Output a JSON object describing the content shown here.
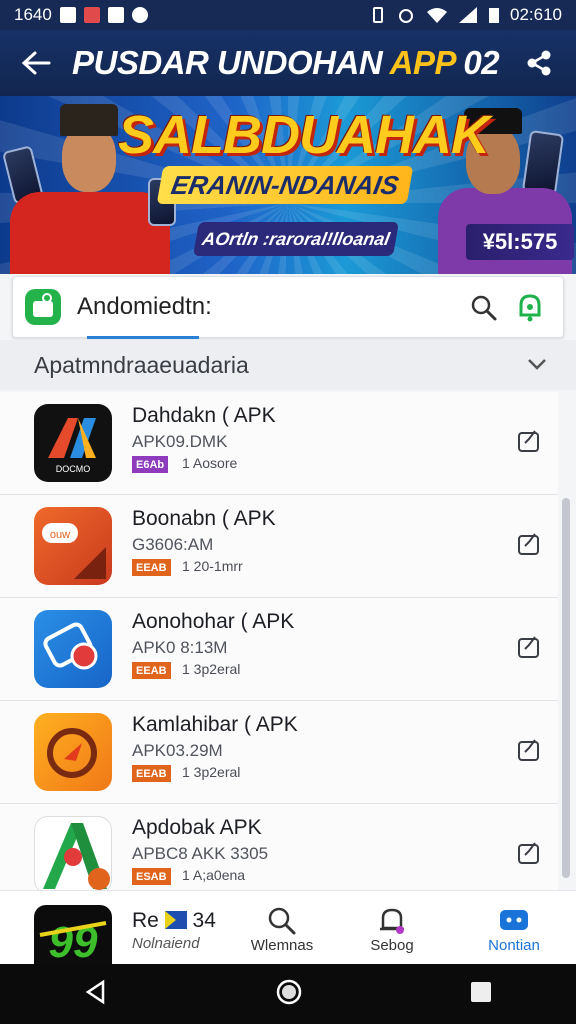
{
  "status_bar": {
    "time_left": "1640",
    "time_right": "02:610"
  },
  "header": {
    "title_main": "PUSDAR UNDOHAN ",
    "title_accent": "APP",
    "title_suffix": " 02"
  },
  "banner": {
    "headline": "SALBDUAHAK",
    "subheadline": "ERANIN-NDANAIS",
    "cta": "AOrtln :raroral!lloanal",
    "price": "¥5l:575"
  },
  "search": {
    "value": "Andomiedtn:"
  },
  "section": {
    "title": "Apatmndraaeuadaria"
  },
  "apps": [
    {
      "name": "Dahdakn ( APK",
      "size": "APK09.DMK",
      "badge": "E6Ab",
      "badge_color": "#8e3bbd",
      "meta": "1 Aosore"
    },
    {
      "name": "Boonabn ( APK",
      "size": "G3606:AM",
      "badge": "EEAB",
      "badge_color": "#e0641c",
      "meta": "1 20-1mrr"
    },
    {
      "name": "Aonohohar ( APK",
      "size": "APK0 8:13M",
      "badge": "EEAB",
      "badge_color": "#e0641c",
      "meta": "1 3p2eral"
    },
    {
      "name": "Kamlahibar ( APK",
      "size": "APK03.29M",
      "badge": "EEAB",
      "badge_color": "#e0641c",
      "meta": "1 3p2eral"
    },
    {
      "name": "Apdobak APK",
      "size": "APBC8 AKK 3305",
      "badge": "ESAB",
      "badge_color": "#e0641c",
      "meta": "1 A;a0ena"
    }
  ],
  "partial_app": {
    "name": "Re",
    "name_suffix": "34",
    "sub": "Nolnaiend"
  },
  "bottom_nav": [
    {
      "label": "Wlemnas",
      "icon": "search-icon"
    },
    {
      "label": "Sebog",
      "icon": "bell-icon"
    },
    {
      "label": "Nontian",
      "icon": "chat-icon"
    }
  ]
}
